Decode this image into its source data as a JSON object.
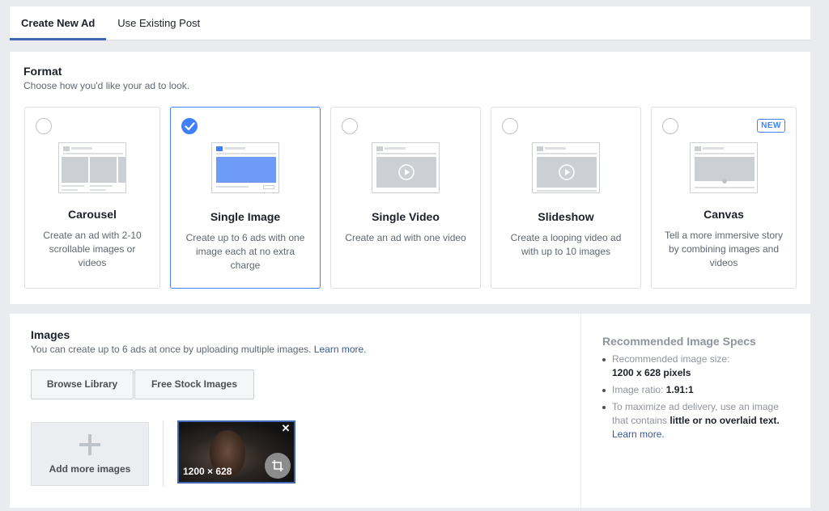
{
  "tabs": [
    {
      "label": "Create New Ad",
      "active": true
    },
    {
      "label": "Use Existing Post",
      "active": false
    }
  ],
  "format": {
    "title": "Format",
    "subtitle": "Choose how you'd like your ad to look.",
    "cards": [
      {
        "name": "carousel",
        "title": "Carousel",
        "desc": "Create an ad with 2-10 scrollable images or videos",
        "selected": false
      },
      {
        "name": "single-image",
        "title": "Single Image",
        "desc": "Create up to 6 ads with one image each at no extra charge",
        "selected": true
      },
      {
        "name": "single-video",
        "title": "Single Video",
        "desc": "Create an ad with one video",
        "selected": false
      },
      {
        "name": "slideshow",
        "title": "Slideshow",
        "desc": "Create a looping video ad with up to 10 images",
        "selected": false
      },
      {
        "name": "canvas",
        "title": "Canvas",
        "desc": "Tell a more immersive story by combining images and videos",
        "selected": false,
        "badge": "NEW"
      }
    ]
  },
  "images": {
    "title": "Images",
    "subtitle": "You can create up to 6 ads at once by uploading multiple images.",
    "learn_more": "Learn more.",
    "browse_label": "Browse Library",
    "stock_label": "Free Stock Images",
    "add_more_label": "Add more images",
    "preview_dims": "1200 × 628",
    "close_glyph": "✕"
  },
  "specs": {
    "title": "Recommended Image Specs",
    "size_label": "Recommended image size:",
    "size_value": "1200 x 628 pixels",
    "ratio_label": "Image ratio: ",
    "ratio_value": "1.91:1",
    "delivery_text": "To maximize ad delivery, use an image that contains ",
    "delivery_bold": "little or no overlaid text.",
    "learn_more": "Learn more."
  },
  "colors": {
    "accent": "#4080ff",
    "link": "#365899",
    "background": "#e9ebee"
  }
}
